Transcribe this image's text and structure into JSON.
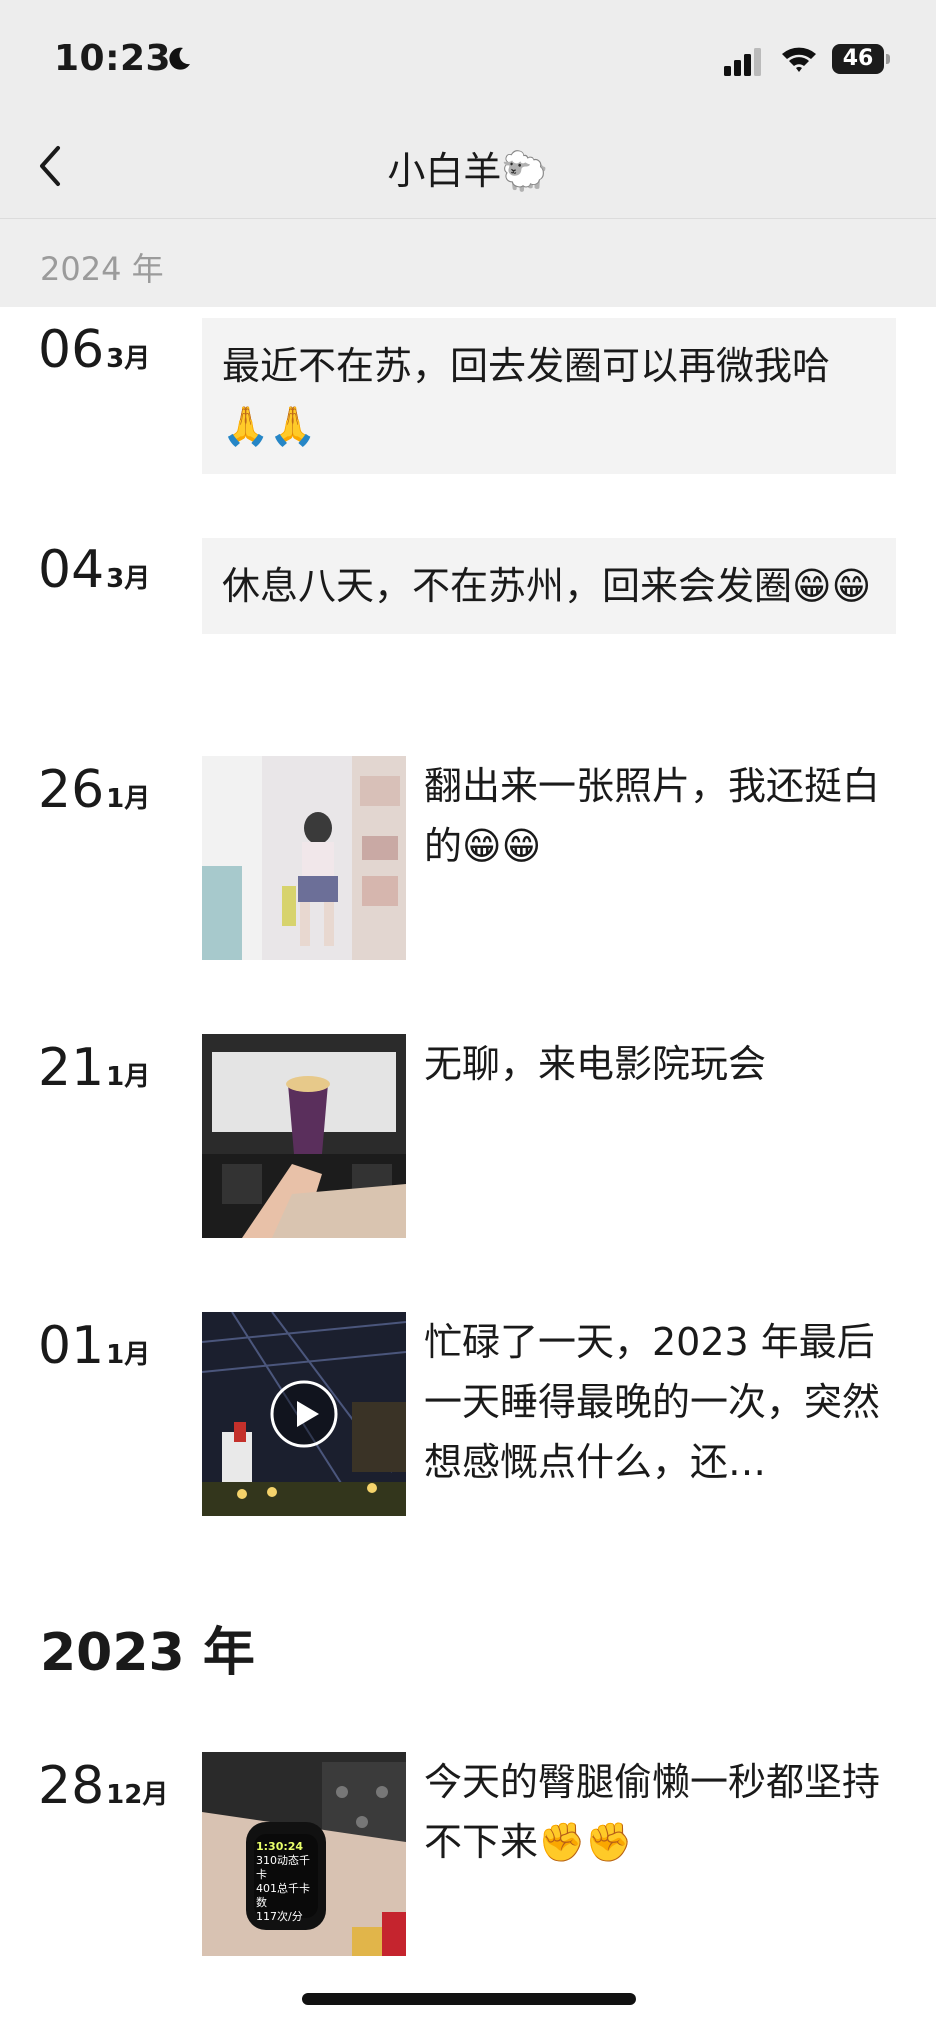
{
  "status": {
    "time": "10:23",
    "battery": "46"
  },
  "header": {
    "title": "小白羊🐑",
    "year_label": "2024 年"
  },
  "posts": [
    {
      "day": "06",
      "month": "3月",
      "text": "最近不在苏，回去发圈可以再微我哈🙏🙏"
    },
    {
      "day": "04",
      "month": "3月",
      "text": "休息八天，不在苏州，回来会发圈😁😁"
    },
    {
      "day": "26",
      "month": "1月",
      "text": "翻出来一张照片，我还挺白的😁😁"
    },
    {
      "day": "21",
      "month": "1月",
      "text": "无聊，来电影院玩会"
    },
    {
      "day": "01",
      "month": "1月",
      "text": "忙碌了一天，2023 年最后一天睡得最晚的一次，突然想感慨点什么，还…"
    },
    {
      "day": "28",
      "month": "12月",
      "text": "今天的臀腿偷懒一秒都坚持不下来✊✊"
    }
  ],
  "year_2023": "2023 年",
  "watch": {
    "time": "1:30:24",
    "line1": "310动态千卡",
    "line2": "401总千卡数",
    "line3": "117次/分"
  },
  "colors": {
    "header_bg": "#ededed",
    "text_box_bg": "#f3f3f3",
    "muted": "#9b9b9b"
  }
}
